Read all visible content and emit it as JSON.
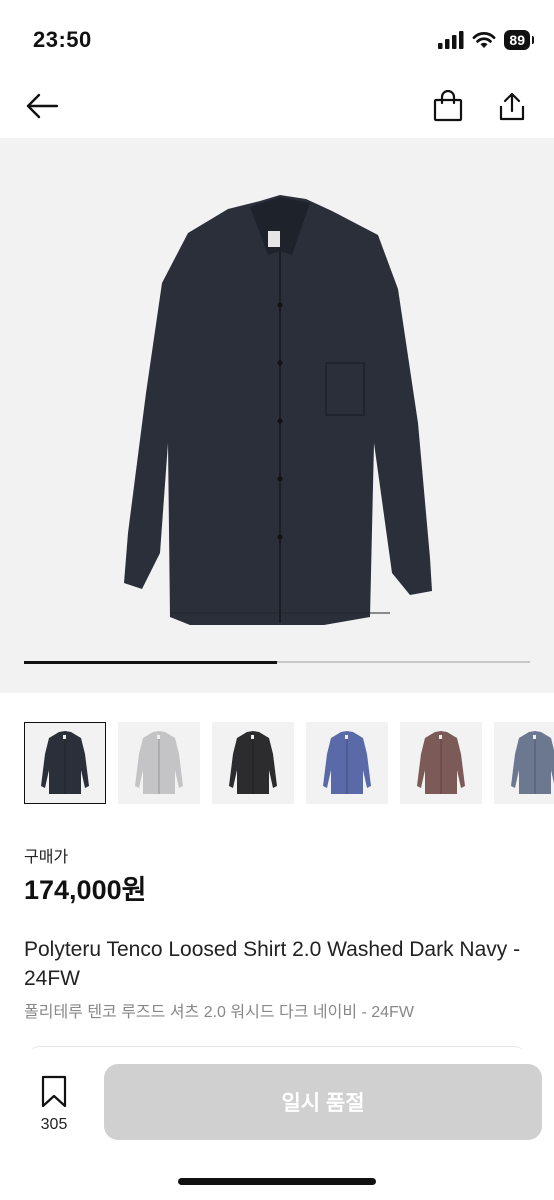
{
  "status_bar": {
    "time": "23:50",
    "battery": "89"
  },
  "hero": {
    "gallery_progress": 0.5
  },
  "thumbnails": [
    {
      "color": "#2a2f3a",
      "selected": true
    },
    {
      "color": "#c4c4c6",
      "selected": false
    },
    {
      "color": "#2c2c2e",
      "selected": false
    },
    {
      "color": "#5a6aa8",
      "selected": false
    },
    {
      "color": "#7b5a58",
      "selected": false
    },
    {
      "color": "#6c7890",
      "selected": false
    }
  ],
  "product": {
    "price_label": "구매가",
    "price": "174,000원",
    "title_en": "Polyteru Tenco Loosed Shirt 2.0 Washed Dark Navy - 24FW",
    "title_ko": "폴리테루 텐코 루즈드 셔츠 2.0 워시드 다크 네이비 - 24FW"
  },
  "bottom_bar": {
    "wish_count": "305",
    "cta_label": "일시 품절"
  },
  "icons": {
    "back": "arrow-left-icon",
    "bag": "shopping-bag-icon",
    "share": "share-icon",
    "bookmark": "bookmark-icon"
  }
}
